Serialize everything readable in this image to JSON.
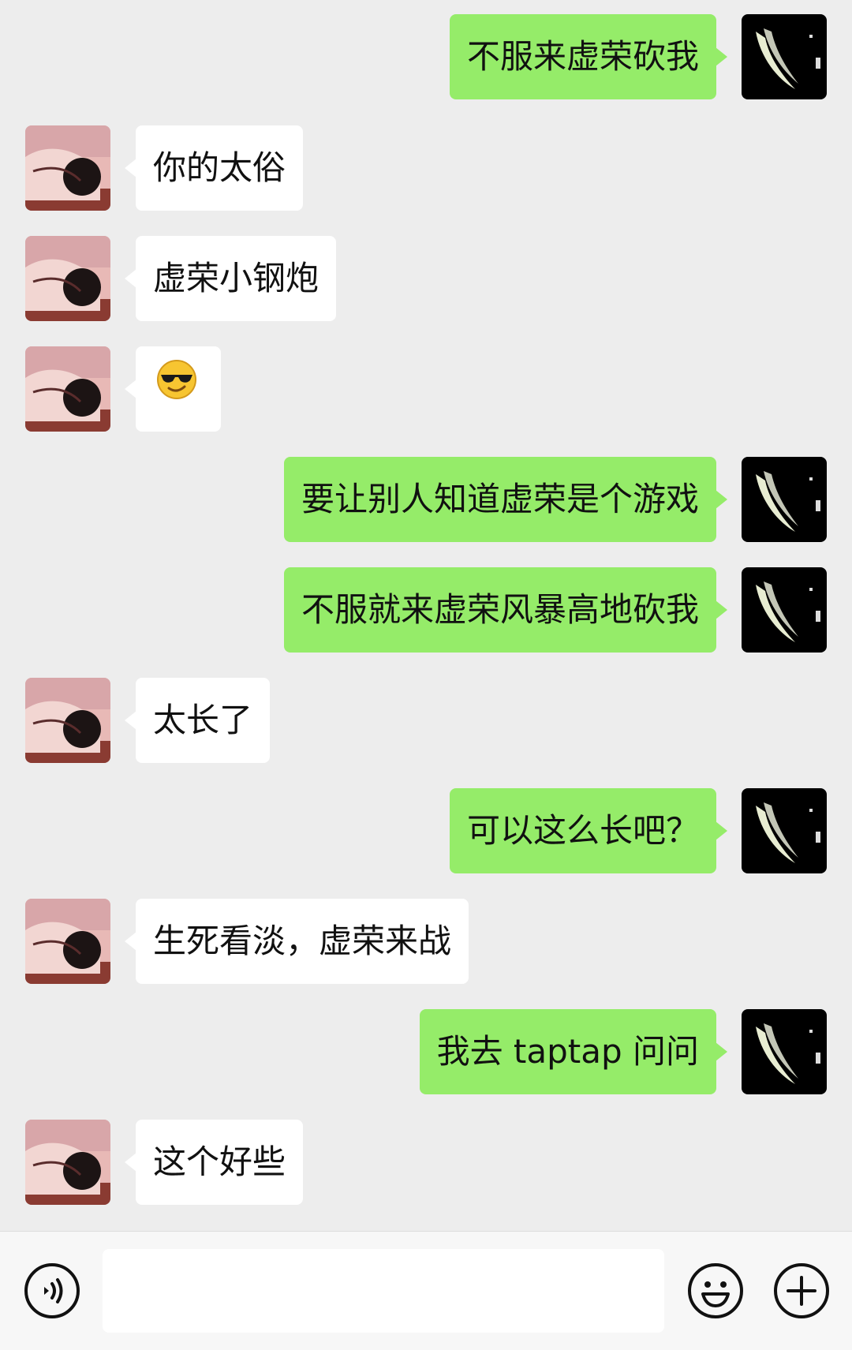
{
  "messages": [
    {
      "side": "right",
      "text": "不服来虚荣砍我"
    },
    {
      "side": "left",
      "text": "你的太俗"
    },
    {
      "side": "left",
      "text": "虚荣小钢炮"
    },
    {
      "side": "left",
      "text": "",
      "emoji": "sunglasses-emoji"
    },
    {
      "side": "right",
      "text": "要让别人知道虚荣是个游戏"
    },
    {
      "side": "right",
      "text": "不服就来虚荣风暴高地砍我"
    },
    {
      "side": "left",
      "text": "太长了"
    },
    {
      "side": "right",
      "text": "可以这么长吧？"
    },
    {
      "side": "left",
      "text": "生死看淡，虚荣来战"
    },
    {
      "side": "right",
      "text": "我去 taptap 问问"
    },
    {
      "side": "left",
      "text": "这个好些"
    }
  ],
  "input_bar": {
    "voice_icon": "voice-icon",
    "input_value": "",
    "emoji_icon": "emoji-icon",
    "plus_icon": "plus-icon"
  },
  "colors": {
    "background": "#ededed",
    "sent_bubble": "#95ec69",
    "received_bubble": "#ffffff"
  }
}
